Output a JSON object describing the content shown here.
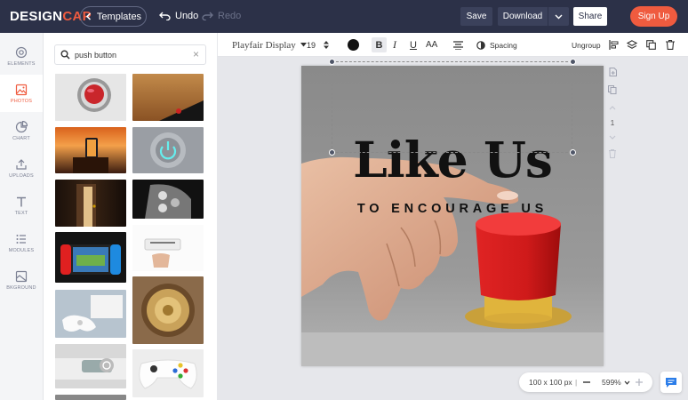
{
  "header": {
    "logo_a": "DESIGN",
    "logo_b": "CAP",
    "templates_label": "Templates",
    "undo_label": "Undo",
    "redo_label": "Redo",
    "save_label": "Save",
    "download_label": "Download",
    "share_label": "Share",
    "signup_label": "Sign Up"
  },
  "rail": {
    "items": [
      {
        "label": "ELEMENTS",
        "icon": "elements-icon"
      },
      {
        "label": "PHOTOS",
        "icon": "photo-icon",
        "active": true
      },
      {
        "label": "CHART",
        "icon": "chart-icon"
      },
      {
        "label": "UPLOADS",
        "icon": "upload-icon"
      },
      {
        "label": "TEXT",
        "icon": "text-icon"
      },
      {
        "label": "MODULES",
        "icon": "modules-icon"
      },
      {
        "label": "BKGROUND",
        "icon": "background-icon"
      }
    ]
  },
  "search": {
    "value": "push button",
    "clear_glyph": "×"
  },
  "toolbar": {
    "font": "Playfair Display",
    "size": "19",
    "bold": "B",
    "italic": "I",
    "underline": "U",
    "case": "AA",
    "spacing": "Spacing",
    "ungroup": "Ungroup"
  },
  "canvas": {
    "headline": "Like Us",
    "subline": "TO ENCOURAGE US"
  },
  "side_tools": {
    "page_number": "1"
  },
  "footer": {
    "dims": "100 x 100 px",
    "divider": "|",
    "zoom": "599%"
  },
  "colors": {
    "topbar": "#2c3148",
    "accent": "#ef5b3f",
    "canvas_bg": "#878787"
  }
}
